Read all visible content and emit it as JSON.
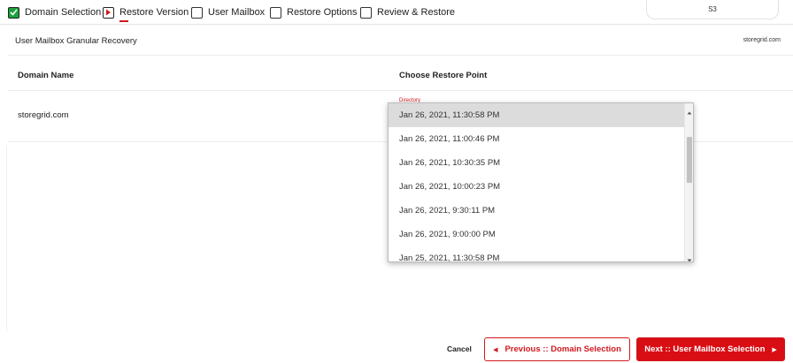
{
  "wizard": {
    "steps": [
      {
        "label": "Domain Selection",
        "state": "done"
      },
      {
        "label": "Restore Version",
        "state": "active"
      },
      {
        "label": "User Mailbox",
        "state": "pending"
      },
      {
        "label": "Restore Options",
        "state": "pending"
      },
      {
        "label": "Review & Restore",
        "state": "pending"
      }
    ],
    "storage_tab": "S3"
  },
  "panel": {
    "title": "User Mailbox Granular Recovery",
    "brand": "storegrid.com"
  },
  "table": {
    "columns": [
      "Domain Name",
      "Choose Restore Point"
    ],
    "rows": [
      {
        "domain": "storegrid.com",
        "restore_label": "Directory"
      }
    ]
  },
  "dropdown": {
    "options": [
      "Jan 26, 2021, 11:30:58 PM",
      "Jan 26, 2021, 11:00:46 PM",
      "Jan 26, 2021, 10:30:35 PM",
      "Jan 26, 2021, 10:00:23 PM",
      "Jan 26, 2021, 9:30:11 PM",
      "Jan 26, 2021, 9:00:00 PM",
      "Jan 25, 2021, 11:30:58 PM"
    ],
    "highlighted": "Jan 26, 2021, 11:30:58 PM"
  },
  "footer": {
    "cancel_label": "Cancel",
    "previous_label": "Previous :: Domain Selection",
    "next_label": "Next :: User Mailbox Selection"
  },
  "colors": {
    "accent": "#d90e14",
    "done": "#19a33a",
    "highlight": "#dcdcdc"
  }
}
